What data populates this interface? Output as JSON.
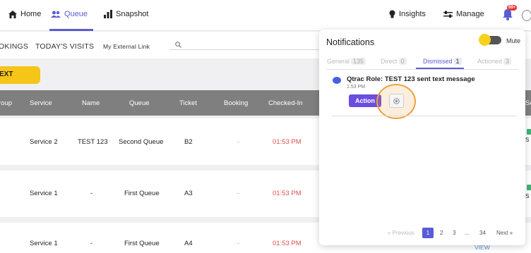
{
  "nav": {
    "items": [
      {
        "label": "Home",
        "icon": "home-icon"
      },
      {
        "label": "Queue",
        "icon": "users-icon",
        "active": true
      },
      {
        "label": "Snapshot",
        "icon": "bar-chart-icon"
      }
    ],
    "insights": "Insights",
    "manage": "Manage",
    "badge": "99+"
  },
  "subnav": {
    "tabs": [
      "OKINGS",
      "TODAY'S VISITS",
      "My External Link"
    ]
  },
  "next_label": "EXT",
  "table": {
    "headers": [
      "roup",
      "Service",
      "Name",
      "Queue",
      "Ticket",
      "Booking",
      "Checked-In"
    ],
    "rows": [
      {
        "service": "Service 2",
        "name": "TEST 123",
        "queue": "Second Queue",
        "ticket": "B2",
        "booking": "-",
        "checked_in": "01:53 PM"
      },
      {
        "service": "Service 1",
        "name": "-",
        "queue": "First Queue",
        "ticket": "A3",
        "booking": "-",
        "checked_in": "01:53 PM"
      },
      {
        "service": "Service 1",
        "name": "-",
        "queue": "First Queue",
        "ticket": "A4",
        "booking": "-",
        "checked_in": "01:53 PM"
      }
    ],
    "right_edge": {
      "header": "Se",
      "row1": "S",
      "row2": "S",
      "view": "VIEW"
    }
  },
  "notifications": {
    "title": "Notifications",
    "mute_label": "Mute",
    "tabs": [
      {
        "label": "General",
        "count": "135"
      },
      {
        "label": "Direct",
        "count": "0"
      },
      {
        "label": "Dismissed",
        "count": "1",
        "active": true
      },
      {
        "label": "Actioned",
        "count": "3"
      }
    ],
    "message": {
      "title": "Qtrac Role: TEST 123 sent text message",
      "time": "1:53 PM",
      "action_label": "Action"
    },
    "pagination": {
      "previous": "« Previous",
      "pages": [
        "1",
        "2",
        "3",
        "...",
        "34"
      ],
      "next": "Next »"
    }
  },
  "colors": {
    "accent": "#5b5bd6",
    "yellow": "#f5c518",
    "header_gray": "#7f7f7f",
    "time_red": "#d9534f"
  }
}
